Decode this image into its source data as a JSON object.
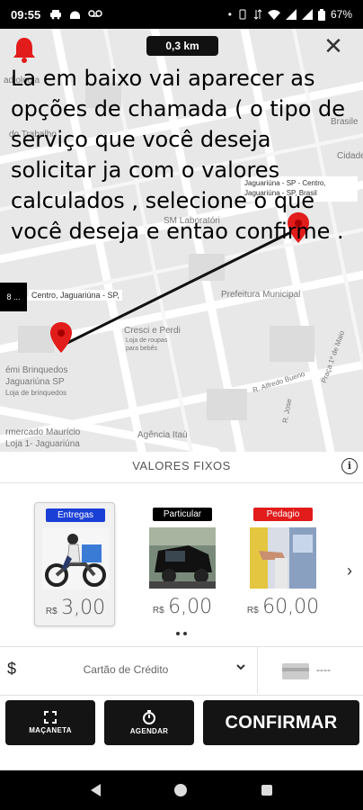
{
  "status_bar": {
    "time": "09:55",
    "left_icons": [
      "car-icon",
      "android-icon",
      "voicemail-icon"
    ],
    "right_icons": [
      "dot-icon",
      "vibrate-icon",
      "data-icon",
      "wifi-icon",
      "signal-icon",
      "signal-icon-2",
      "battery-icon"
    ],
    "battery": "67%"
  },
  "map": {
    "distance": "0,3 km",
    "overlay_text": "La em baixo vai aparecer as opções de chamada ( o tipo de serviço que você deseja solicitar ja com o valores calculados , selecione o que você deseja e entao confirme .",
    "origin_label": "Centro, Jaguariúna - SP,",
    "destination_label": "Jaguariúna - SP - Centro, Jaguariúna - SP, Brasil",
    "side_tab_text": "8 ...",
    "labels": {
      "radiologia": "adiologia",
      "do_trabalho": "do Trabalho",
      "brasilia": "Brasile",
      "cidade": "Cidade",
      "sm_laboratorio": "SM Laboratóri",
      "prefeitura": "Prefeitura Municipal",
      "cresci": "Cresci e Perdi",
      "cresci_sub": "Loja de roupas",
      "cresci_sub2": "para bebês",
      "brinquedos": "émi Brinquedos",
      "brinquedos2": "Jaguariúna SP",
      "brinquedos3": "Loja de brinquedos",
      "mercado": "rmercado Maurício",
      "mercado2": "Loja 1- Jaguariúna",
      "itau": "Agência Itaú",
      "rua_alfredo": "R. Alfredo Bueno",
      "praca": "Praça 1º de Maio",
      "rua_jose": "R. Jose"
    }
  },
  "panel": {
    "title": "VALORES FIXOS",
    "services": [
      {
        "badge": "Entregas",
        "badge_color": "#1a3fd6",
        "currency": "R$",
        "price": "3,00",
        "image": "motorcycle-courier"
      },
      {
        "badge": "Particular",
        "badge_color": "#000000",
        "currency": "R$",
        "price": "6,00",
        "image": "black-car"
      },
      {
        "badge": "Pedagio",
        "badge_color": "#e21b1b",
        "currency": "R$",
        "price": "60,00",
        "image": "toll-booth"
      }
    ],
    "payment": {
      "currency_symbol": "$",
      "method": "Cartão de Crédito",
      "card_digits": "----"
    },
    "buttons": {
      "macaneta": "MAÇANETA",
      "agendar": "AGENDAR",
      "confirmar": "CONFIRMAR"
    }
  }
}
